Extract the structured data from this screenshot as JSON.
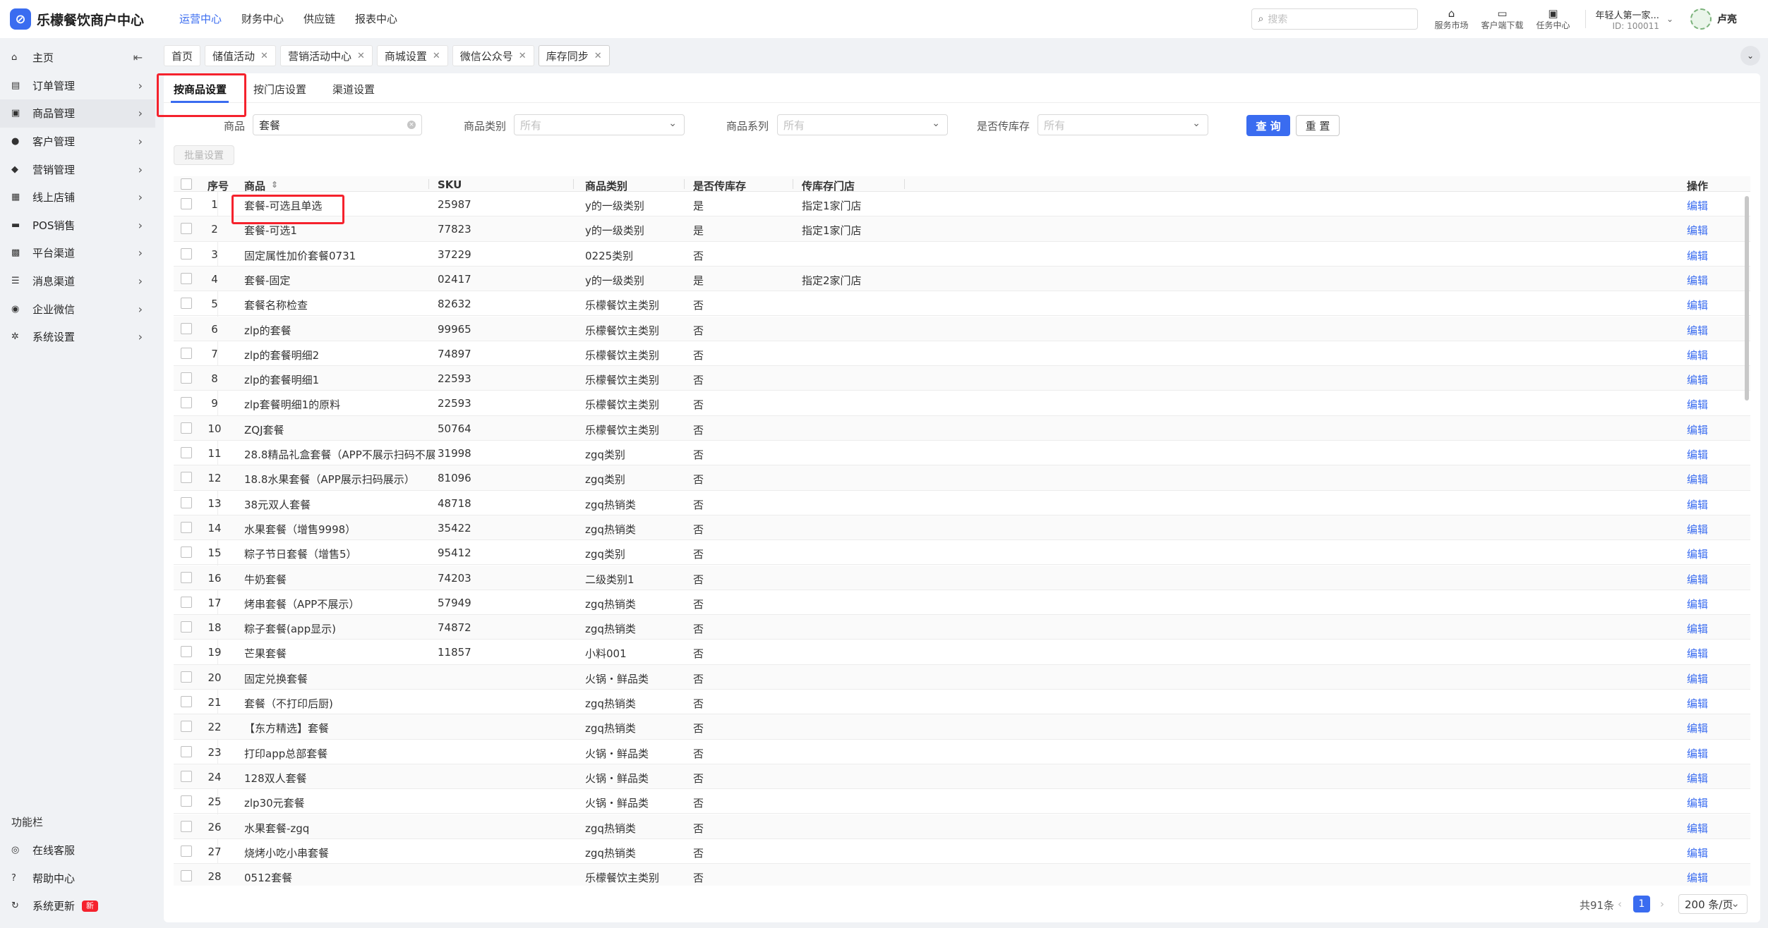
{
  "app": {
    "name": "乐檬餐饮商户中心"
  },
  "topnav": [
    "运营中心",
    "财务中心",
    "供应链",
    "报表中心"
  ],
  "search_placeholder": "搜索",
  "tools": [
    {
      "label": "服务市场",
      "icon": "shop-icon"
    },
    {
      "label": "客户端下载",
      "icon": "folder-icon"
    },
    {
      "label": "任务中心",
      "icon": "task-icon"
    }
  ],
  "org": {
    "name": "年轻人第一家...",
    "id": "ID: 100011"
  },
  "user": {
    "name": "卢亮"
  },
  "sidebar": {
    "items": [
      {
        "label": "主页",
        "icon": "home-icon",
        "glyph": "⌂",
        "chev": "⇤"
      },
      {
        "label": "订单管理",
        "icon": "order-icon",
        "glyph": "▤",
        "chev": "›"
      },
      {
        "label": "商品管理",
        "icon": "goods-icon",
        "glyph": "▣",
        "chev": "›"
      },
      {
        "label": "客户管理",
        "icon": "user-icon",
        "glyph": "●",
        "chev": "›"
      },
      {
        "label": "营销管理",
        "icon": "tag-icon",
        "glyph": "◆",
        "chev": "›"
      },
      {
        "label": "线上店铺",
        "icon": "cart-icon",
        "glyph": "▦",
        "chev": "›"
      },
      {
        "label": "POS销售",
        "icon": "pos-icon",
        "glyph": "▬",
        "chev": "›"
      },
      {
        "label": "平台渠道",
        "icon": "platform-icon",
        "glyph": "▩",
        "chev": "›"
      },
      {
        "label": "消息渠道",
        "icon": "message-icon",
        "glyph": "☰",
        "chev": "›"
      },
      {
        "label": "企业微信",
        "icon": "wechat-icon",
        "glyph": "◉",
        "chev": "›"
      },
      {
        "label": "系统设置",
        "icon": "gear-icon",
        "glyph": "✲",
        "chev": "›"
      }
    ],
    "footer_title": "功能栏",
    "footer": [
      {
        "label": "在线客服",
        "icon": "headset-icon",
        "glyph": "◎"
      },
      {
        "label": "帮助中心",
        "icon": "help-icon",
        "glyph": "?"
      },
      {
        "label": "系统更新",
        "icon": "refresh-icon",
        "glyph": "↻",
        "badge": "新"
      }
    ]
  },
  "tabs": [
    {
      "label": "首页",
      "closable": false
    },
    {
      "label": "储值活动",
      "closable": true
    },
    {
      "label": "营销活动中心",
      "closable": true
    },
    {
      "label": "商城设置",
      "closable": true
    },
    {
      "label": "微信公众号",
      "closable": true
    },
    {
      "label": "库存同步",
      "closable": true
    }
  ],
  "subtabs": [
    "按商品设置",
    "按门店设置",
    "渠道设置"
  ],
  "filters": {
    "product_label": "商品",
    "product_value": "套餐",
    "category_label": "商品类别",
    "category_placeholder": "所有",
    "series_label": "商品系列",
    "series_placeholder": "所有",
    "sync_label": "是否传库存",
    "sync_placeholder": "所有",
    "query": "查 询",
    "reset": "重 置"
  },
  "batch_button": "批量设置",
  "table": {
    "headers": {
      "index": "序号",
      "product": "商品",
      "sku": "SKU",
      "category": "商品类别",
      "sync": "是否传库存",
      "store": "传库存门店",
      "action": "操作"
    },
    "rows": [
      [
        "1",
        "套餐-可选且单选",
        "25987",
        "y的一级类别",
        "是",
        "指定1家门店"
      ],
      [
        "2",
        "套餐-可选1",
        "77823",
        "y的一级类别",
        "是",
        "指定1家门店"
      ],
      [
        "3",
        "固定属性加价套餐0731",
        "37229",
        "0225类别",
        "否",
        ""
      ],
      [
        "4",
        "套餐-固定",
        "02417",
        "y的一级类别",
        "是",
        "指定2家门店"
      ],
      [
        "5",
        "套餐名称检查",
        "82632",
        "乐檬餐饮主类别",
        "否",
        ""
      ],
      [
        "6",
        "zlp的套餐",
        "99965",
        "乐檬餐饮主类别",
        "否",
        ""
      ],
      [
        "7",
        "zlp的套餐明细2",
        "74897",
        "乐檬餐饮主类别",
        "否",
        ""
      ],
      [
        "8",
        "zlp的套餐明细1",
        "22593",
        "乐檬餐饮主类别",
        "否",
        ""
      ],
      [
        "9",
        "zlp套餐明细1的原料",
        "22593",
        "乐檬餐饮主类别",
        "否",
        ""
      ],
      [
        "10",
        "ZQJ套餐",
        "50764",
        "乐檬餐饮主类别",
        "否",
        ""
      ],
      [
        "11",
        "28.8精品礼盒套餐（APP不展示扫码不展",
        "31998",
        "zgq类别",
        "否",
        ""
      ],
      [
        "12",
        "18.8水果套餐（APP展示扫码展示）",
        "81096",
        "zgq类别",
        "否",
        ""
      ],
      [
        "13",
        "38元双人套餐",
        "48718",
        "zgq热销类",
        "否",
        ""
      ],
      [
        "14",
        "水果套餐（增售9998）",
        "35422",
        "zgq热销类",
        "否",
        ""
      ],
      [
        "15",
        "粽子节日套餐（增售5）",
        "95412",
        "zgq类别",
        "否",
        ""
      ],
      [
        "16",
        "牛奶套餐",
        "74203",
        "二级类别1",
        "否",
        ""
      ],
      [
        "17",
        "烤串套餐（APP不展示）",
        "57949",
        "zgq热销类",
        "否",
        ""
      ],
      [
        "18",
        "粽子套餐(app显示)",
        "74872",
        "zgq热销类",
        "否",
        ""
      ],
      [
        "19",
        "芒果套餐",
        "11857",
        "小料001",
        "否",
        ""
      ],
      [
        "20",
        "固定兑换套餐",
        "",
        "火锅・鲜品类",
        "否",
        ""
      ],
      [
        "21",
        "套餐（不打印后厨)",
        "",
        "zgq热销类",
        "否",
        ""
      ],
      [
        "22",
        "【东方精选】套餐",
        "",
        "zgq热销类",
        "否",
        ""
      ],
      [
        "23",
        "打印app总部套餐",
        "",
        "火锅・鲜品类",
        "否",
        ""
      ],
      [
        "24",
        "128双人套餐",
        "",
        "火锅・鲜品类",
        "否",
        ""
      ],
      [
        "25",
        "zlp30元套餐",
        "",
        "火锅・鲜品类",
        "否",
        ""
      ],
      [
        "26",
        "水果套餐-zgq",
        "",
        "zgq热销类",
        "否",
        ""
      ],
      [
        "27",
        "烧烤小吃小串套餐",
        "",
        "zgq热销类",
        "否",
        ""
      ],
      [
        "28",
        "0512套餐",
        "",
        "乐檬餐饮主类别",
        "否",
        ""
      ]
    ],
    "action_label": "编辑"
  },
  "pagination": {
    "total": "共91条",
    "current": "1",
    "page_size": "200 条/页"
  }
}
